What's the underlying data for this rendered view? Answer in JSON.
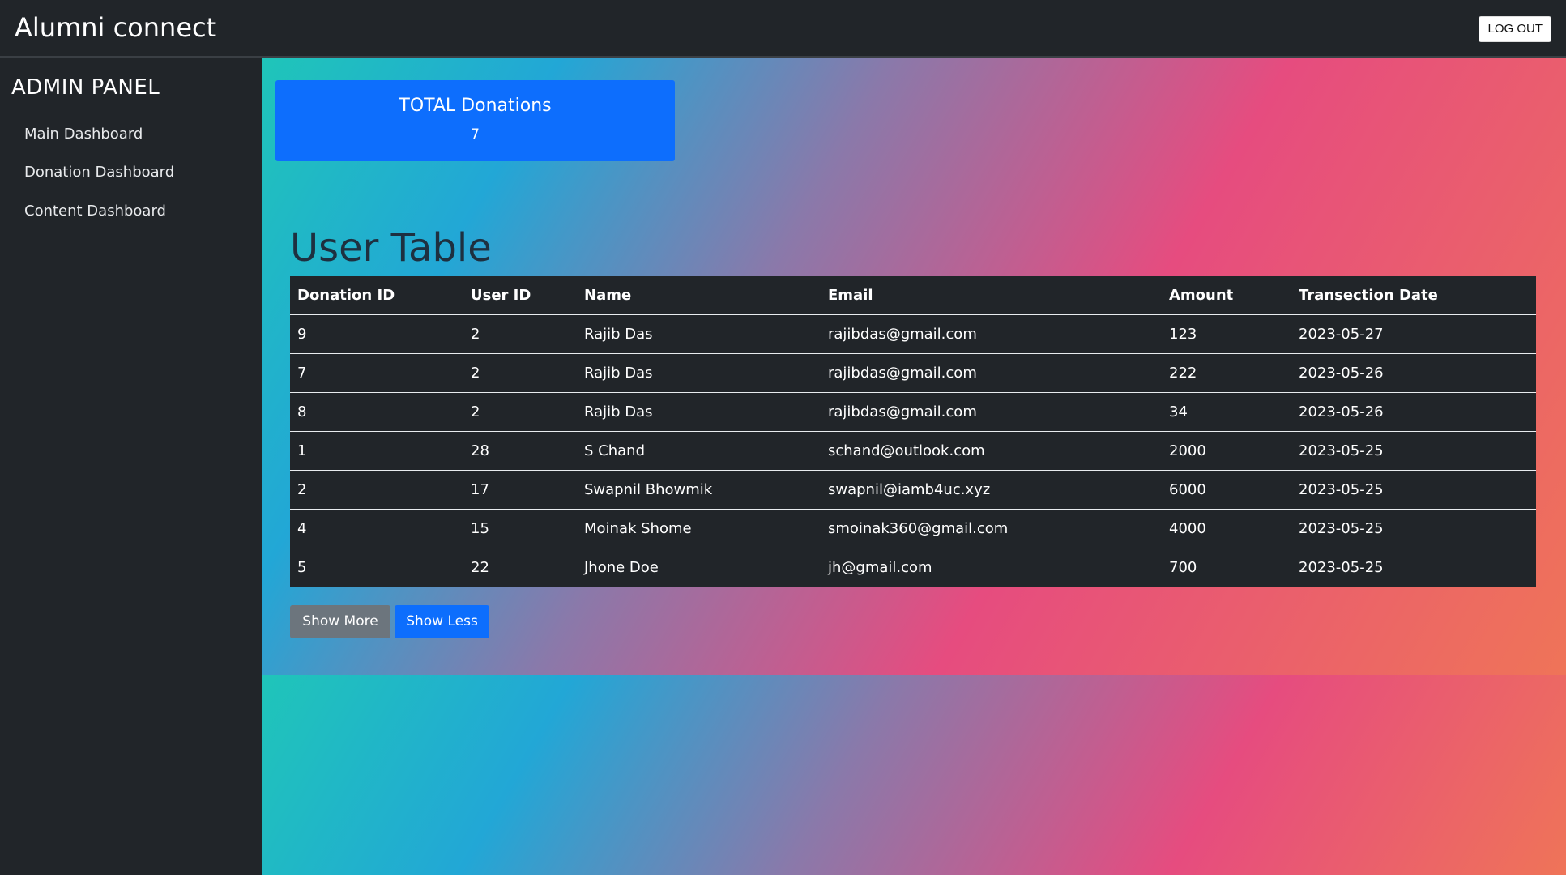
{
  "header": {
    "brand": "Alumni connect",
    "logout_label": "LOG OUT"
  },
  "sidebar": {
    "title": "ADMIN PANEL",
    "items": [
      {
        "label": "Main Dashboard"
      },
      {
        "label": "Donation Dashboard"
      },
      {
        "label": "Content Dashboard"
      }
    ]
  },
  "summary": {
    "total_title": "TOTAL Donations",
    "total_value": "7"
  },
  "table": {
    "title": "User Table",
    "columns": [
      "Donation ID",
      "User ID",
      "Name",
      "Email",
      "Amount",
      "Transection Date"
    ],
    "rows": [
      [
        "9",
        "2",
        "Rajib Das",
        "rajibdas@gmail.com",
        "123",
        "2023-05-27"
      ],
      [
        "7",
        "2",
        "Rajib Das",
        "rajibdas@gmail.com",
        "222",
        "2023-05-26"
      ],
      [
        "8",
        "2",
        "Rajib Das",
        "rajibdas@gmail.com",
        "34",
        "2023-05-26"
      ],
      [
        "1",
        "28",
        "S Chand",
        "schand@outlook.com",
        "2000",
        "2023-05-25"
      ],
      [
        "2",
        "17",
        "Swapnil Bhowmik",
        "swapnil@iamb4uc.xyz",
        "6000",
        "2023-05-25"
      ],
      [
        "4",
        "15",
        "Moinak Shome",
        "smoinak360@gmail.com",
        "4000",
        "2023-05-25"
      ],
      [
        "5",
        "22",
        "Jhone Doe",
        "jh@gmail.com",
        "700",
        "2023-05-25"
      ]
    ]
  },
  "buttons": {
    "show_more": "Show More",
    "show_less": "Show Less"
  },
  "colors": {
    "primary": "#0d6efd",
    "secondary": "#6c757d",
    "dark": "#212529"
  }
}
